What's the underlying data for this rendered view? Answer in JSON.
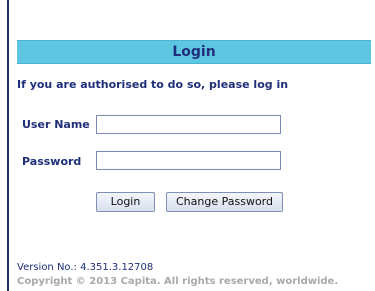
{
  "login": {
    "title": "Login",
    "intro": "If you are authorised to do so, please log in",
    "username_label": "User Name",
    "username_value": "",
    "password_label": "Password",
    "password_value": "",
    "login_button": "Login",
    "change_password_button": "Change Password"
  },
  "footer": {
    "version": "Version No.: 4.351.3.12708",
    "copyright": "Copyright © 2013 Capita. All rights reserved, worldwide."
  },
  "colors": {
    "header_bg": "#5fc6e2",
    "text": "#1f2f7a",
    "left_border": "#1f2f6b",
    "copyright": "#a9a9a9"
  }
}
